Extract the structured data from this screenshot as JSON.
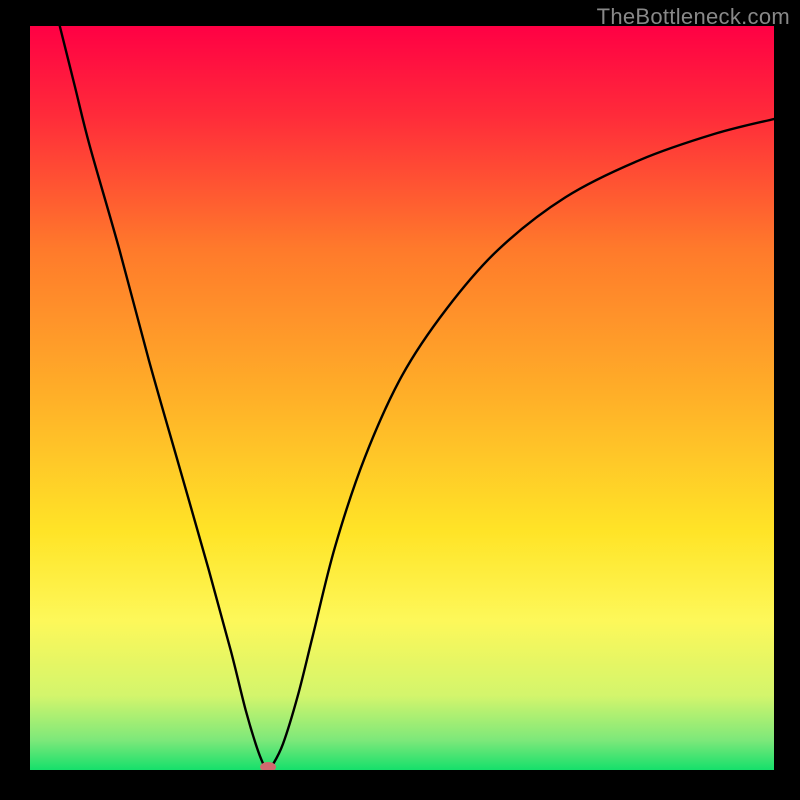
{
  "watermark": "TheBottleneck.com",
  "chart_data": {
    "type": "line",
    "title": "",
    "xlabel": "",
    "ylabel": "",
    "xlim": [
      0,
      100
    ],
    "ylim": [
      0,
      100
    ],
    "background_gradient": {
      "stops": [
        {
          "offset": 0.0,
          "color": "#ff0044"
        },
        {
          "offset": 0.12,
          "color": "#ff2b3a"
        },
        {
          "offset": 0.3,
          "color": "#ff7a2b"
        },
        {
          "offset": 0.5,
          "color": "#ffb028"
        },
        {
          "offset": 0.68,
          "color": "#ffe427"
        },
        {
          "offset": 0.8,
          "color": "#fdf85a"
        },
        {
          "offset": 0.9,
          "color": "#d3f56c"
        },
        {
          "offset": 0.96,
          "color": "#7de87a"
        },
        {
          "offset": 1.0,
          "color": "#15e06b"
        }
      ]
    },
    "series": [
      {
        "name": "bottleneck-curve",
        "stroke": "#000000",
        "points": [
          {
            "x": 4.0,
            "y": 100.0
          },
          {
            "x": 6.0,
            "y": 92.0
          },
          {
            "x": 8.0,
            "y": 84.0
          },
          {
            "x": 12.0,
            "y": 70.0
          },
          {
            "x": 16.0,
            "y": 55.0
          },
          {
            "x": 20.0,
            "y": 41.0
          },
          {
            "x": 24.0,
            "y": 27.0
          },
          {
            "x": 27.0,
            "y": 16.0
          },
          {
            "x": 29.0,
            "y": 8.0
          },
          {
            "x": 30.5,
            "y": 3.0
          },
          {
            "x": 31.5,
            "y": 0.5
          },
          {
            "x": 32.0,
            "y": 0.0
          },
          {
            "x": 32.5,
            "y": 0.5
          },
          {
            "x": 34.0,
            "y": 3.5
          },
          {
            "x": 36.0,
            "y": 10.0
          },
          {
            "x": 38.0,
            "y": 18.0
          },
          {
            "x": 41.0,
            "y": 30.0
          },
          {
            "x": 45.0,
            "y": 42.0
          },
          {
            "x": 50.0,
            "y": 53.0
          },
          {
            "x": 56.0,
            "y": 62.0
          },
          {
            "x": 63.0,
            "y": 70.0
          },
          {
            "x": 72.0,
            "y": 77.0
          },
          {
            "x": 82.0,
            "y": 82.0
          },
          {
            "x": 92.0,
            "y": 85.5
          },
          {
            "x": 100.0,
            "y": 87.5
          }
        ]
      }
    ],
    "marker": {
      "x": 32.0,
      "y": 0.0,
      "color": "#d06a6f"
    },
    "grid": false,
    "legend": false
  }
}
